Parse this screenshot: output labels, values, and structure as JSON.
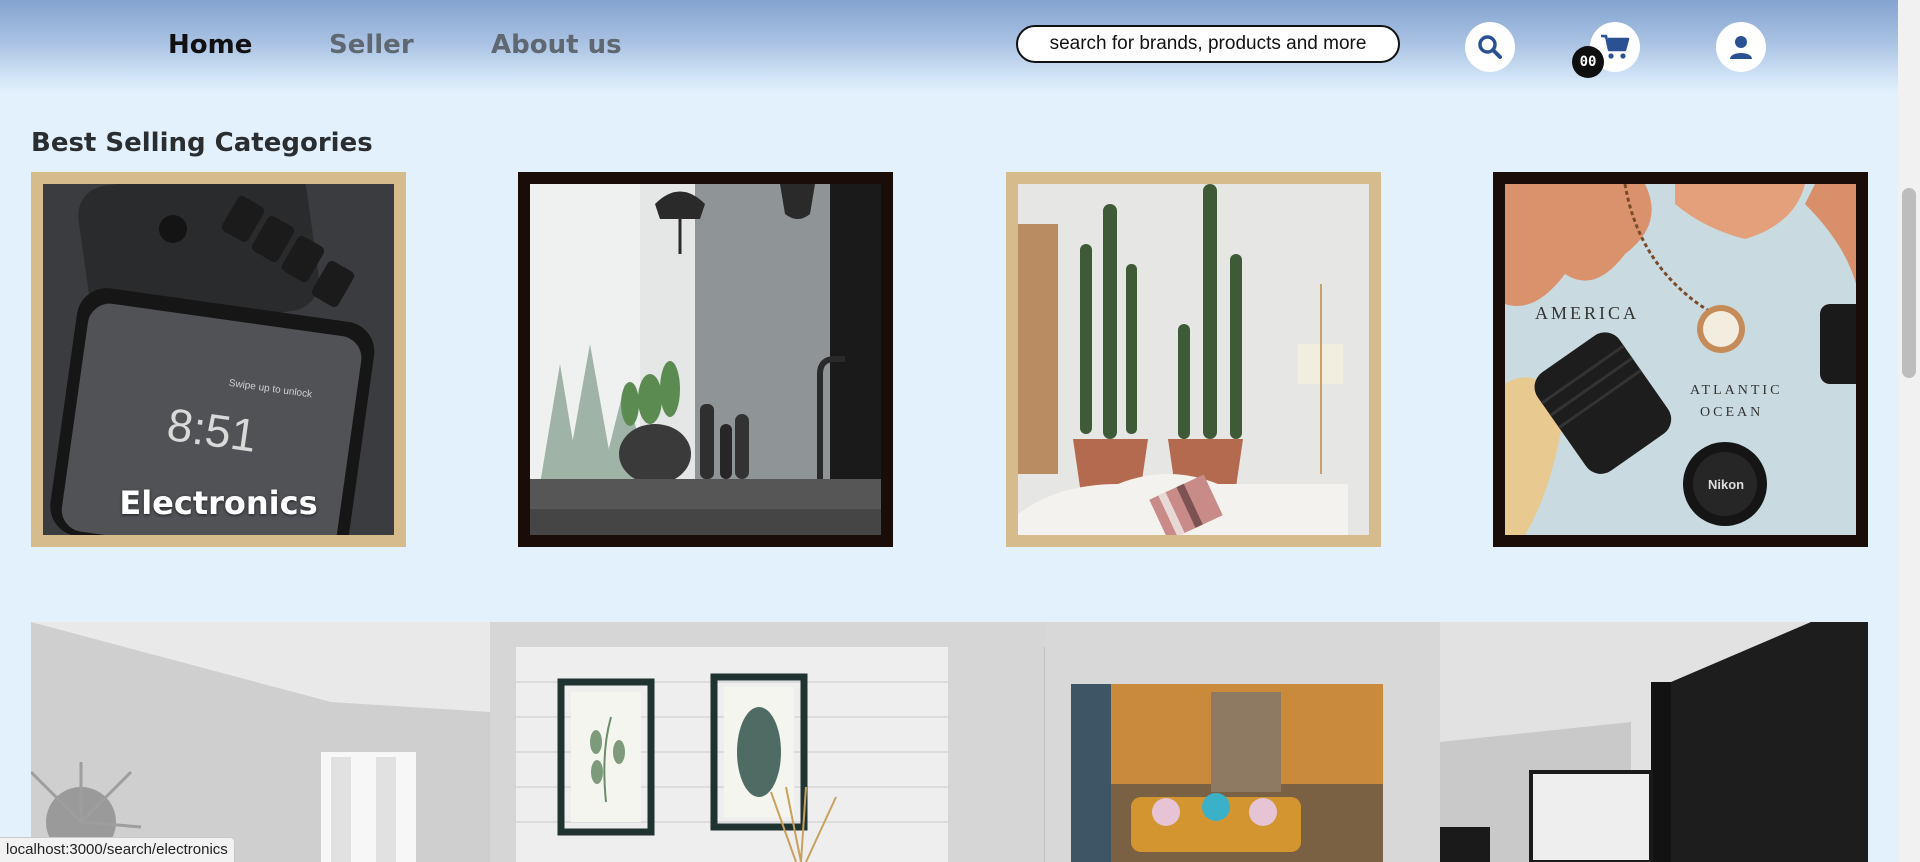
{
  "nav": {
    "home": "Home",
    "seller": "Seller",
    "about": "About us"
  },
  "search": {
    "placeholder": "search for brands, products and more",
    "icon": "search-icon"
  },
  "cart": {
    "count": "00",
    "icon": "cart-icon"
  },
  "account": {
    "icon": "user-icon"
  },
  "section": {
    "title": "Best Selling Categories"
  },
  "categories": [
    {
      "label": "Electronics",
      "frame_color": "#d6bc8c"
    },
    {
      "label": "",
      "frame_color": "#1a0c06"
    },
    {
      "label": "",
      "frame_color": "#d6bc8c"
    },
    {
      "label": "",
      "frame_color": "#1a0c06"
    }
  ],
  "status_bar": {
    "url": "localhost:3000/search/electronics"
  },
  "colors": {
    "accent": "#2a5193",
    "page_bg": "#e3f1fc",
    "header_top": "#84a3cf"
  }
}
